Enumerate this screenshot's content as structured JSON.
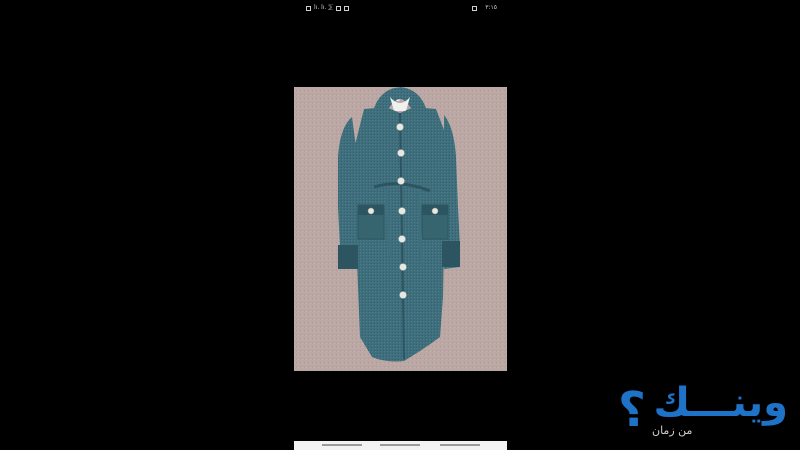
{
  "status_bar": {
    "time": "٣:١٥",
    "left_indicators": "lı. lı. ⅀"
  },
  "photo": {
    "subject": "blue-knit-hooded-long-cardigan",
    "colors": {
      "background": "#bba8a4",
      "garment": "#3f6f7c",
      "garment_dark": "#2d5561",
      "buttons": "#e8e8e2"
    }
  },
  "watermark": {
    "title": "وينـــك",
    "question_mark": "؟",
    "subtitle": "من زمان",
    "color": "#1e73c8"
  },
  "navigation": {
    "buttons": [
      "recent-apps",
      "home",
      "back"
    ]
  }
}
